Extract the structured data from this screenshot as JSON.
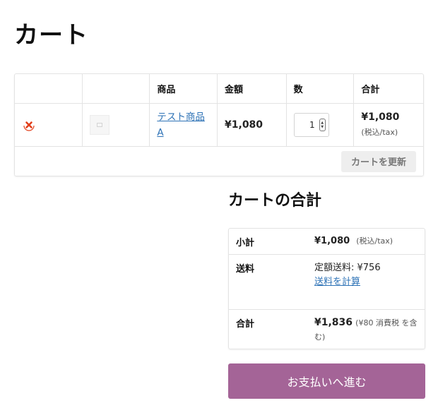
{
  "page": {
    "title": "カート"
  },
  "cart": {
    "headers": [
      "",
      "",
      "商品",
      "金額",
      "数",
      "合計"
    ],
    "item": {
      "remove_icon": "remove-x-icon",
      "thumbnail_icon": "product-thumbnail-icon",
      "product_name": "テスト商品A",
      "price": "¥1,080",
      "quantity": "1",
      "subtotal_price": "¥1,080",
      "subtotal_note": "(税込/tax)"
    },
    "update_button": "カートを更新"
  },
  "totals": {
    "title": "カートの合計",
    "subtotal_label": "小計",
    "subtotal_value": "¥1,080",
    "subtotal_note": "(税込/tax)",
    "shipping_label": "送料",
    "shipping_value": "定額送料: ¥756",
    "shipping_link": "送料を計算",
    "total_label": "合計",
    "total_value": "¥1,836",
    "total_note": "(¥80 消費税 を含む)"
  },
  "checkout_button": "お支払いへ進む",
  "colors": {
    "accent": "#a46497",
    "link": "#2d72b6",
    "remove": "#e2401c"
  }
}
